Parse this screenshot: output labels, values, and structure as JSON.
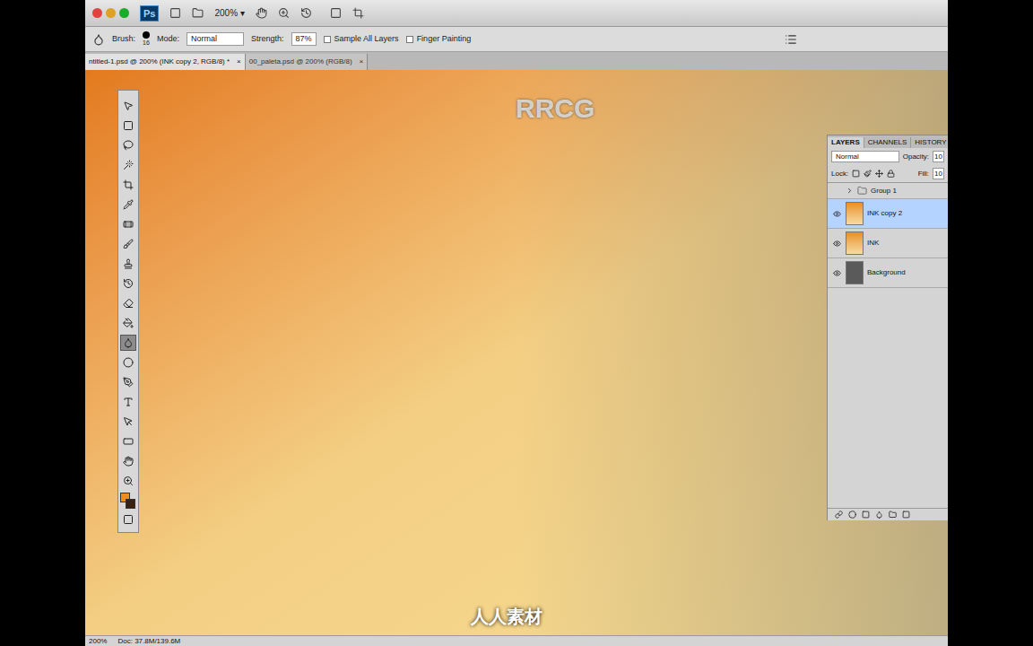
{
  "app_bar": {
    "logo": "Ps",
    "zoom": "200%"
  },
  "options_bar": {
    "brush_label": "Brush:",
    "brush_size": "16",
    "mode_label": "Mode:",
    "mode": "Normal",
    "strength_label": "Strength:",
    "strength": "87%",
    "checkboxes": [
      {
        "label": "Sample All Layers",
        "checked": false
      },
      {
        "label": "Finger Painting",
        "checked": false
      }
    ]
  },
  "tabs": [
    {
      "label": "ntitled-1.psd @ 200% (INK copy 2, RGB/8) *",
      "close": "×",
      "selected": true
    },
    {
      "label": "00_paleta.psd @ 200% (RGB/8)",
      "close": "×",
      "selected": false
    }
  ],
  "tools": [
    {
      "selected": false
    },
    {
      "selected": false
    },
    {
      "selected": false
    },
    {
      "selected": false
    },
    {
      "selected": false
    },
    {
      "selected": false
    },
    {
      "selected": false
    },
    {
      "selected": false
    },
    {
      "selected": false
    },
    {
      "selected": false
    },
    {
      "selected": false
    },
    {
      "selected": false
    },
    {
      "selected": true
    },
    {
      "selected": false
    },
    {
      "selected": false
    },
    {
      "selected": false
    },
    {
      "selected": false
    },
    {
      "selected": false
    },
    {
      "selected": false
    },
    {
      "selected": false
    }
  ],
  "swatches": [
    {
      "color": "#e8901a"
    },
    {
      "color": "#3a2010"
    }
  ],
  "layers_panel": {
    "tabs": [
      {
        "label": "LAYERS",
        "selected": true
      },
      {
        "label": "CHANNELS",
        "selected": false
      },
      {
        "label": "HISTORY",
        "selected": false
      }
    ],
    "blend_mode": "Normal",
    "opacity_label": "Opacity:",
    "opacity": "10",
    "lock_label": "Lock:",
    "fill_label": "Fill:",
    "fill": "10",
    "layers": [
      {
        "name": "Group 1",
        "kind": "group",
        "visible": false,
        "selected": false
      },
      {
        "name": "INK copy 2",
        "kind": "layer",
        "visible": true,
        "selected": true
      },
      {
        "name": "INK",
        "kind": "layer",
        "visible": true,
        "selected": false
      },
      {
        "name": "Background",
        "kind": "background",
        "visible": true,
        "selected": false
      }
    ]
  },
  "watermarks": [
    "RRCG",
    "人人素材"
  ],
  "status_bar": {
    "zoom": "200%",
    "doc": "Doc: 37.8M/139.6M"
  }
}
